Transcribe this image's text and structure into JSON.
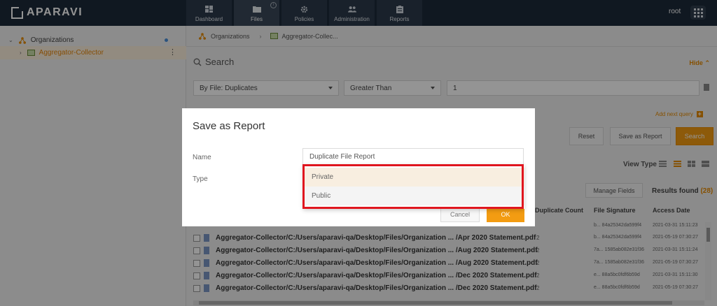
{
  "app": {
    "brand": "APARAVI",
    "user": "root"
  },
  "nav": [
    {
      "label": "Dashboard",
      "icon": "dashboard-icon"
    },
    {
      "label": "Files",
      "icon": "folder-icon",
      "active": true,
      "badge": "i"
    },
    {
      "label": "Policies",
      "icon": "gear-icon"
    },
    {
      "label": "Administration",
      "icon": "users-icon"
    },
    {
      "label": "Reports",
      "icon": "clipboard-icon"
    }
  ],
  "sidebar": {
    "items": [
      {
        "label": "Organizations"
      },
      {
        "label": "Aggregator-Collector"
      }
    ]
  },
  "breadcrumb": {
    "root": "Organizations",
    "current": "Aggregator-Collec..."
  },
  "search": {
    "title": "Search",
    "hide": "Hide",
    "field": "By File: Duplicates",
    "operator": "Greater Than",
    "value": "1",
    "add_query": "Add next query",
    "reset": "Reset",
    "save_as_report": "Save as Report",
    "search": "Search"
  },
  "results": {
    "view_type": "View Type",
    "manage_fields": "Manage Fields",
    "results_found": "Results found",
    "count": "(28)",
    "columns": [
      "Duplicate Count",
      "File Signature",
      "Access Date"
    ],
    "rows": [
      {
        "path": "Aggregator-Collector/C:/Users/aparavi-qa/Desktop/Files/Organization ...",
        "file": "/Apr 2020 Statement.pdf",
        "dup": "2",
        "sig": "b... 84a25342da599f4",
        "access": "2021-05-19 07:30:27"
      },
      {
        "path": "Aggregator-Collector/C:/Users/aparavi-qa/Desktop/Files/Organization ...",
        "file": "/Aug 2020 Statement.pdf",
        "dup": "2",
        "sig": "7a... 1585ab082e31f36",
        "access": "2021-03-31 15:11:24"
      },
      {
        "path": "Aggregator-Collector/C:/Users/aparavi-qa/Desktop/Files/Organization ...",
        "file": "/Aug 2020 Statement.pdf",
        "dup": "2",
        "sig": "7a... 1585ab082e31f36",
        "access": "2021-05-19 07:30:27"
      },
      {
        "path": "Aggregator-Collector/C:/Users/aparavi-qa/Desktop/Files/Organization ...",
        "file": "/Dec 2020 Statement.pdf",
        "dup": "2",
        "sig": "e... 88a5bc0fdf6b59d",
        "access": "2021-03-31 15:11:30"
      },
      {
        "path": "Aggregator-Collector/C:/Users/aparavi-qa/Desktop/Files/Organization ...",
        "file": "/Dec 2020 Statement.pdf",
        "dup": "2",
        "sig": "e... 88a5bc0fdf6b59d",
        "access": "2021-05-19 07:30:27"
      }
    ],
    "first_row_sig": "b... 84a25342da599f4",
    "first_row_access": "2021-03-31 15:11:23"
  },
  "modal": {
    "title": "Save as Report",
    "name_label": "Name",
    "name_value": "Duplicate File Report",
    "type_label": "Type",
    "options": [
      "Private",
      "Public"
    ],
    "cancel": "Cancel",
    "ok": "OK"
  },
  "colors": {
    "accent": "#f39c12",
    "topbar": "#1c2a39",
    "highlight": "#e0161f"
  }
}
